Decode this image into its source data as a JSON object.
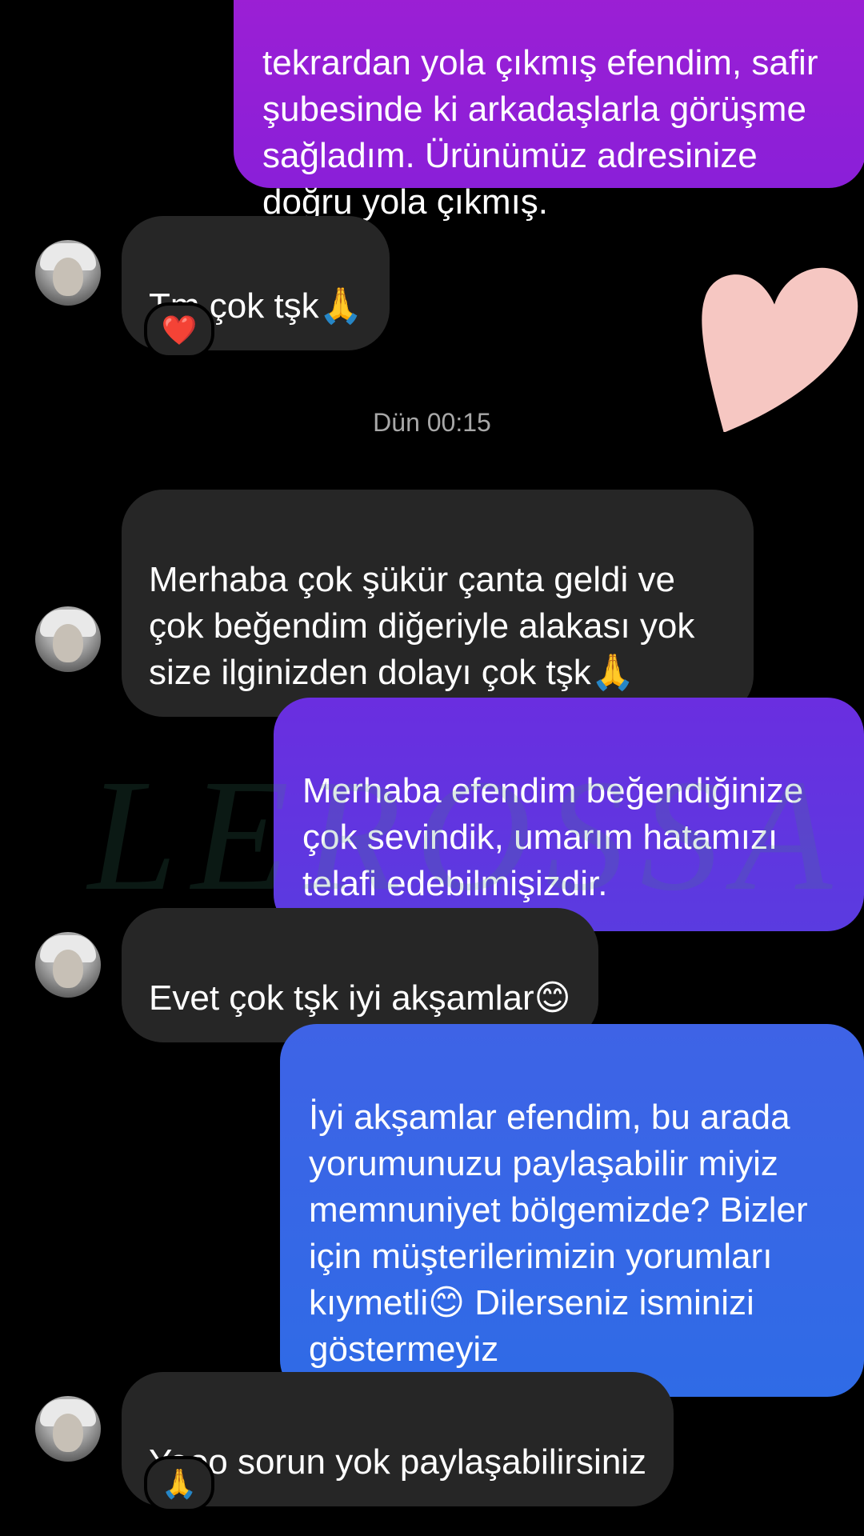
{
  "messages": [
    {
      "id": "out1",
      "text": "tekrardan yola çıkmış efendim, safir\nşubesinde ki arkadaşlarla görüşme\nsağladım. Ürünümüz adresinize\ndoğru yola çıkmış."
    },
    {
      "id": "in1",
      "text": "Tm çok tşk🙏",
      "reaction": "❤️"
    },
    {
      "id": "in2",
      "text": "Merhaba çok şükür çanta geldi ve\nçok beğendim diğeriyle alakası yok\nsize ilginizden dolayı çok tşk🙏"
    },
    {
      "id": "out2",
      "text": "Merhaba efendim beğendiğinize\nçok sevindik, umarım hatamızı\ntelafi edebilmişizdir."
    },
    {
      "id": "in3",
      "text": "Evet çok tşk iyi akşamlar😊"
    },
    {
      "id": "out3",
      "text": "İyi akşamlar efendim, bu arada\nyorumunuzu paylaşabilir miyiz\nmemnuniyet bölgemizde? Bizler\niçin müşterilerimizin yorumları\nkıymetli😊 Dilerseniz isminizi\ngöstermeyiz"
    },
    {
      "id": "in4",
      "text": "Yooo sorun yok paylaşabilirsiniz",
      "reaction": "🙏"
    }
  ],
  "timestamp": "Dün 00:15",
  "watermark": "LEROSSA",
  "colors": {
    "background": "#000000",
    "incoming_bubble": "#262626",
    "outgoing_purple": "#8a22d6",
    "outgoing_violet": "#5a3be0",
    "outgoing_blue": "#2f6be6",
    "heart_sticker": "#f6c7c2"
  },
  "icons": {
    "heart_reaction": "red-heart-icon",
    "pray_reaction": "folded-hands-icon",
    "sticker": "heart-sticker-icon"
  }
}
